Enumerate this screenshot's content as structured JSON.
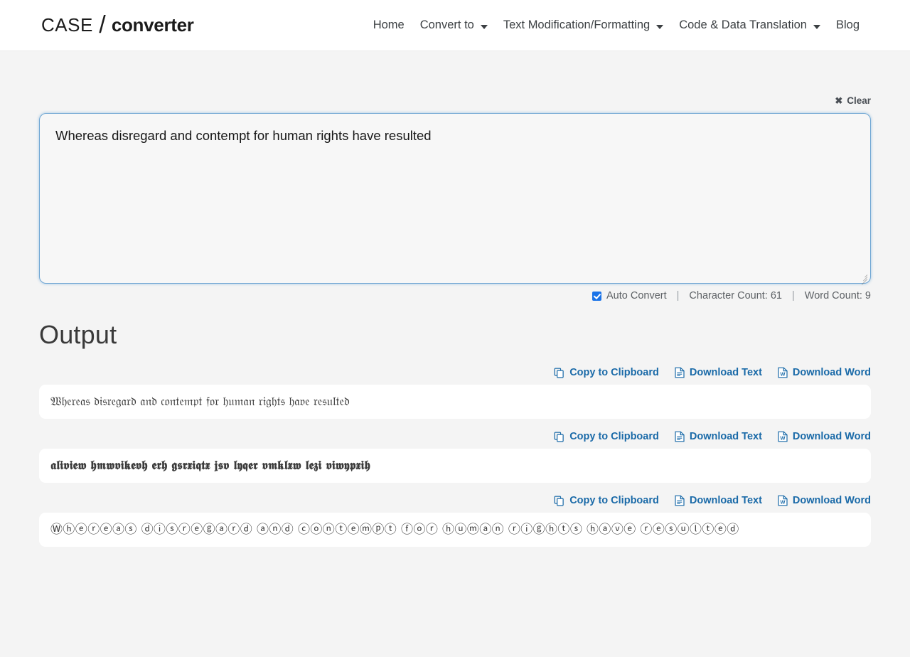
{
  "header": {
    "logo": {
      "part1": "CASE",
      "slash": "/",
      "part2": "converter"
    },
    "nav": [
      {
        "label": "Home",
        "has_caret": false
      },
      {
        "label": "Convert to",
        "has_caret": true
      },
      {
        "label": "Text Modification/Formatting",
        "has_caret": true
      },
      {
        "label": "Code & Data Translation",
        "has_caret": true
      },
      {
        "label": "Blog",
        "has_caret": false
      }
    ]
  },
  "toolbar": {
    "clear_label": "Clear",
    "clear_icon": "close-x-icon",
    "clear_glyph": "✖"
  },
  "input": {
    "value": "Whereas disregard and contempt for human rights have resulted",
    "placeholder": "",
    "focused": true
  },
  "stats": {
    "auto_convert_label": "Auto Convert",
    "auto_convert_checked": true,
    "separator": "|",
    "character_count_label": "Character Count: 61",
    "word_count_label": "Word Count: 9"
  },
  "output": {
    "title": "Output",
    "actions": [
      {
        "label": "Copy to Clipboard",
        "icon": "copy-icon"
      },
      {
        "label": "Download Text",
        "icon": "download-text-icon"
      },
      {
        "label": "Download Word",
        "icon": "download-word-icon"
      }
    ],
    "results": [
      {
        "style": "fraktur",
        "text": "𝔚𝔥𝔢𝔯𝔢𝔞𝔰 𝔡𝔦𝔰𝔯𝔢𝔤𝔞𝔯𝔡 𝔞𝔫𝔡 𝔠𝔬𝔫𝔱𝔢𝔪𝔭𝔱 𝔣𝔬𝔯 𝔥𝔲𝔪𝔞𝔫 𝔯𝔦𝔤𝔥𝔱𝔰 𝔥𝔞𝔳𝔢 𝔯𝔢𝔰𝔲𝔩𝔱𝔢𝔡"
      },
      {
        "style": "fraktur-bold",
        "text": "𝖆𝖑𝖎𝖛𝖎𝖊𝖜 𝖍𝖒𝖜𝖛𝖎𝖐𝖊𝖛𝖍 𝖊𝖗𝖍 𝖌𝖘𝖗𝖝𝖎𝖖𝖙𝖝 𝖏𝖘𝖛 𝖑𝖞𝖖𝖊𝖗 𝖛𝖒𝖐𝖑𝖝𝖜 𝖑𝖊𝖟𝖎 𝖛𝖎𝖜𝖞𝖕𝖝𝖎𝖍"
      },
      {
        "style": "circled",
        "text": "Ⓦⓗⓔⓡⓔⓐⓢ ⓓⓘⓢⓡⓔⓖⓐⓡⓓ ⓐⓝⓓ ⓒⓞⓝⓣⓔⓜⓟⓣ ⓕⓞⓡ ⓗⓤⓜⓐⓝ ⓡⓘⓖⓗⓣⓢ ⓗⓐⓥⓔ ⓡⓔⓢⓤⓛⓣⓔⓓ"
      }
    ]
  },
  "colors": {
    "page_bg": "#f4f4f4",
    "header_bg": "#ffffff",
    "link_blue": "#1a6aa8",
    "focus_blue": "#71a7d4",
    "checkbox_blue": "#1a73e8",
    "text_dark": "#3c4043"
  }
}
